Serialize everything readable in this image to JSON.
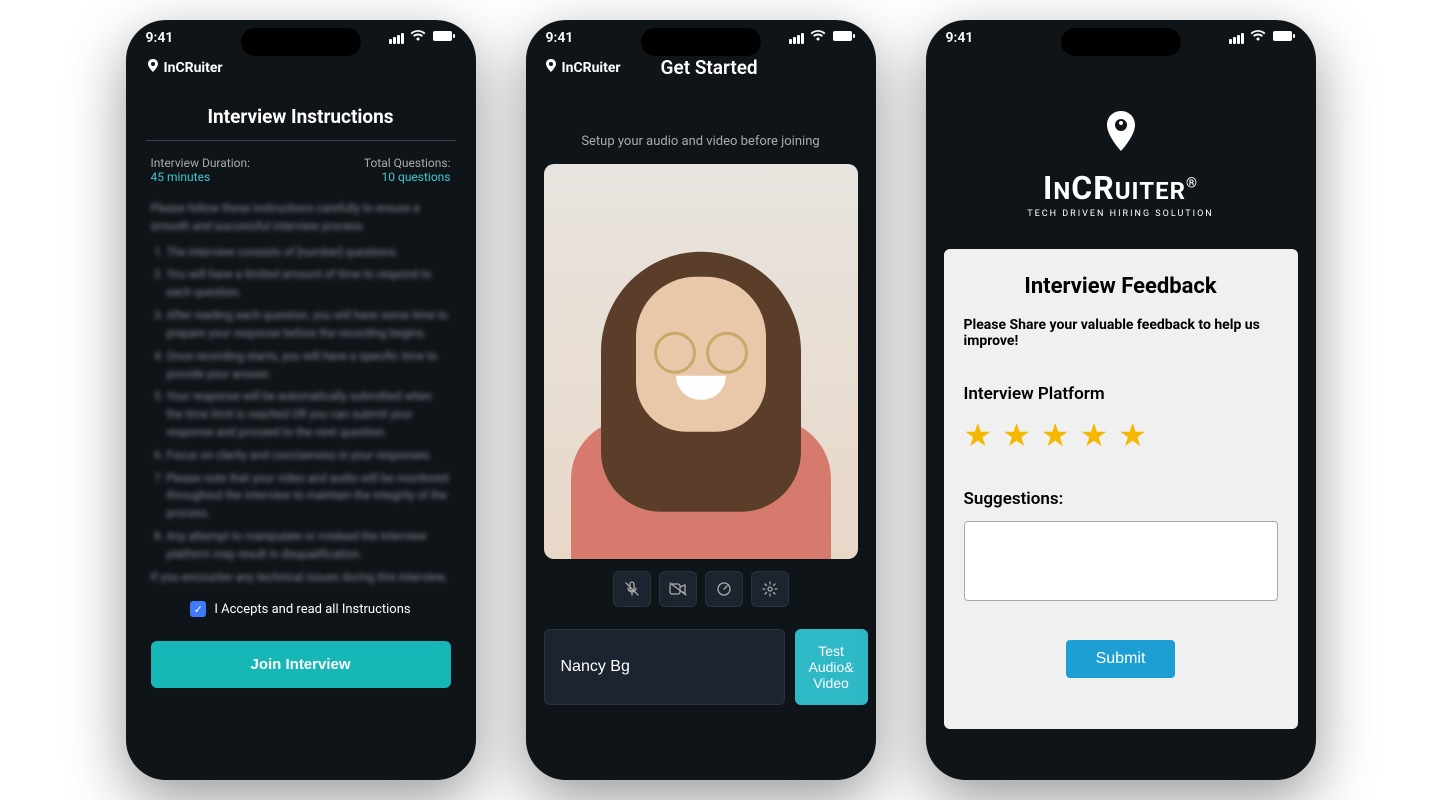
{
  "status": {
    "time": "9:41"
  },
  "brand": {
    "name": "InCRuiter",
    "tagline": "TECH DRIVEN HIRING SOLUTION"
  },
  "screen1": {
    "title": "Interview Instructions",
    "duration_label": "Interview Duration:",
    "duration_value": "45 minutes",
    "questions_label": "Total Questions:",
    "questions_value": "10 questions",
    "blur_intro": "Please follow these instructions carefully to ensure a smooth and successful interview process.",
    "blur_items": [
      "The interview consists of [number] questions.",
      "You will have a limited amount of time to respond to each question.",
      "After reading each question, you will have some time to prepare your response before the recording begins.",
      "Once recording starts, you will have a specific time to provide your answer.",
      "Your response will be automatically submitted when the time limit is reached OR you can submit your response and proceed to the next question.",
      "Focus on clarity and conciseness in your responses.",
      "Please note that your video and audio will be monitored throughout the interview to maintain the integrity of the process.",
      "Any attempt to manipulate or mislead the interview platform may result in disqualification."
    ],
    "blur_footer": "If you encounter any technical issues during this interview, please contact our technical support team at [InCruiter Technical Support Email] for assistance. Thank you for participating. Your responses will help us assess your fit for the [Job Position] role. Good luck!",
    "consent": "I Accepts and read all Instructions",
    "join_button": "Join Interview"
  },
  "screen2": {
    "title": "Get Started",
    "hint": "Setup your audio and video before joining",
    "name_value": "Nancy Bg",
    "test_button": "Test Audio& Video"
  },
  "screen3": {
    "title": "Interview Feedback",
    "subtitle": "Please Share your valuable feedback to help us improve!",
    "platform_label": "Interview Platform",
    "rating": 5,
    "suggestions_label": "Suggestions:",
    "submit_button": "Submit"
  }
}
